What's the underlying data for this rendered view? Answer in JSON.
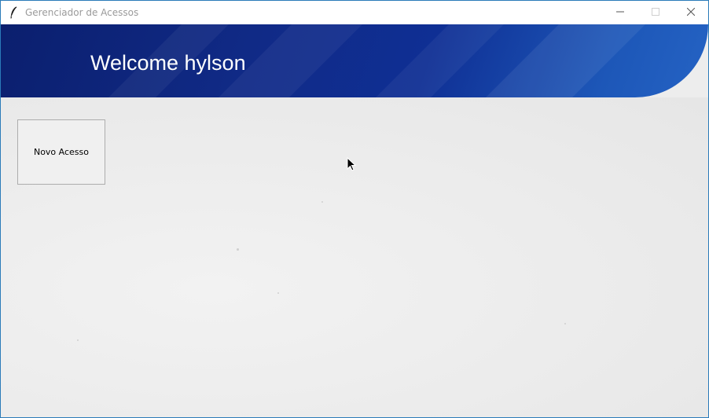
{
  "window": {
    "title": "Gerenciador de Acessos",
    "app_icon": "feather-icon",
    "controls": [
      "minimize-icon",
      "maximize-icon",
      "close-icon"
    ]
  },
  "banner": {
    "welcome_text": "Welcome hylson",
    "colors": {
      "dark": "#0b1f6e",
      "light": "#2563c4"
    }
  },
  "content": {
    "buttons": {
      "novo_acesso_label": "Novo Acesso"
    },
    "background_color": "#ededed"
  }
}
